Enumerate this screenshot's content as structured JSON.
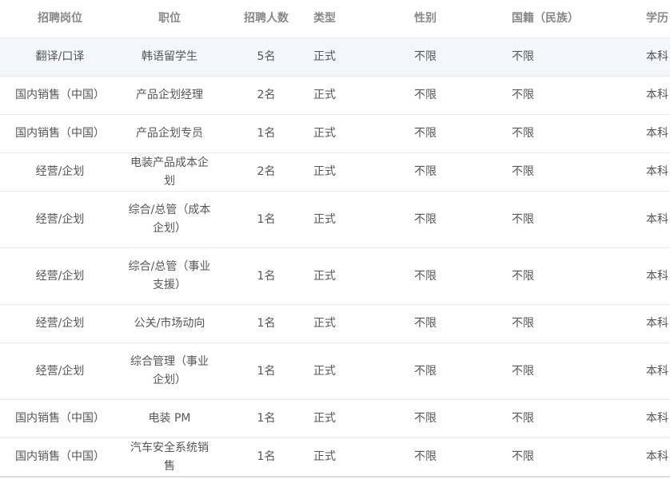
{
  "table": {
    "columns": [
      "招聘岗位",
      "职位",
      "招聘人数",
      "类型",
      "性别",
      "国籍（民族）",
      "学历"
    ],
    "rows": [
      {
        "dept": "翻译/口译",
        "title": "韩语留学生",
        "count": "5名",
        "type": "正式",
        "gender": "不限",
        "nationality": "不限",
        "edu": "本科"
      },
      {
        "dept": "国内销售（中国）",
        "title": "产品企划经理",
        "count": "2名",
        "type": "正式",
        "gender": "不限",
        "nationality": "不限",
        "edu": "本科"
      },
      {
        "dept": "国内销售（中国）",
        "title": "产品企划专员",
        "count": "1名",
        "type": "正式",
        "gender": "不限",
        "nationality": "不限",
        "edu": "本科"
      },
      {
        "dept": "经营/企划",
        "title": "电装产品成本企划",
        "count": "2名",
        "type": "正式",
        "gender": "不限",
        "nationality": "不限",
        "edu": "本科"
      },
      {
        "dept": "经营/企划",
        "title": "综合/总管（成本企划）",
        "count": "1名",
        "type": "正式",
        "gender": "不限",
        "nationality": "不限",
        "edu": "本科"
      },
      {
        "dept": "经营/企划",
        "title": "综合/总管（事业支援）",
        "count": "1名",
        "type": "正式",
        "gender": "不限",
        "nationality": "不限",
        "edu": "本科"
      },
      {
        "dept": "经营/企划",
        "title": "公关/市场动向",
        "count": "1名",
        "type": "正式",
        "gender": "不限",
        "nationality": "不限",
        "edu": "本科"
      },
      {
        "dept": "经营/企划",
        "title": "综合管理（事业企划）",
        "count": "1名",
        "type": "正式",
        "gender": "不限",
        "nationality": "不限",
        "edu": "本科"
      },
      {
        "dept": "国内销售（中国）",
        "title": "电装 PM",
        "count": "1名",
        "type": "正式",
        "gender": "不限",
        "nationality": "不限",
        "edu": "本科"
      },
      {
        "dept": "国内销售（中国）",
        "title": "汽车安全系统销售",
        "count": "1名",
        "type": "正式",
        "gender": "不限",
        "nationality": "不限",
        "edu": "本科"
      }
    ]
  }
}
